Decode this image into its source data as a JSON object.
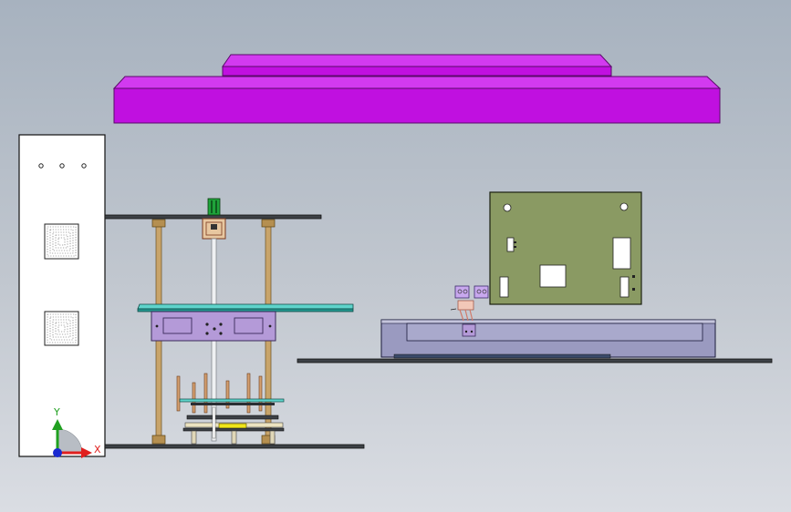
{
  "viewport": {
    "background_top": "#a7b2bf",
    "background_bottom": "#dadde3"
  },
  "colors": {
    "magenta_cover": "#c010e0",
    "magenta_cover_edge": "#8a0aa4",
    "cyan_plate": "#2fb7ae",
    "lavender_panel": "#b49ad8",
    "circuit_board": "#8a9a63",
    "base_tray": "#9a9ac0",
    "rod_gold": "#c8a46a",
    "triad_x": "#e0201e",
    "triad_y": "#20a020",
    "triad_z": "#1a2ad0"
  },
  "triad": {
    "x_label": "X",
    "y_label": "Y"
  }
}
